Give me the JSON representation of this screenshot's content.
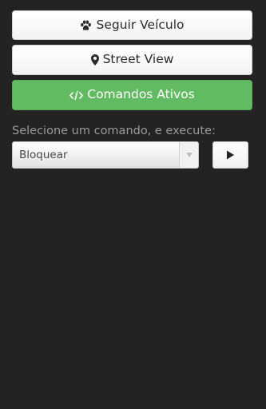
{
  "buttons": {
    "follow_vehicle": {
      "label": "Seguir Veículo",
      "icon": "paw-icon"
    },
    "street_view": {
      "label": "Street View",
      "icon": "map-marker-icon"
    },
    "active_commands": {
      "label": "Comandos Ativos",
      "icon": "code-icon"
    }
  },
  "command": {
    "prompt": "Selecione um comando, e execute:",
    "selected": "Bloquear",
    "execute_icon": "play-icon"
  },
  "colors": {
    "background": "#232323",
    "accent_green": "#62bb62"
  }
}
